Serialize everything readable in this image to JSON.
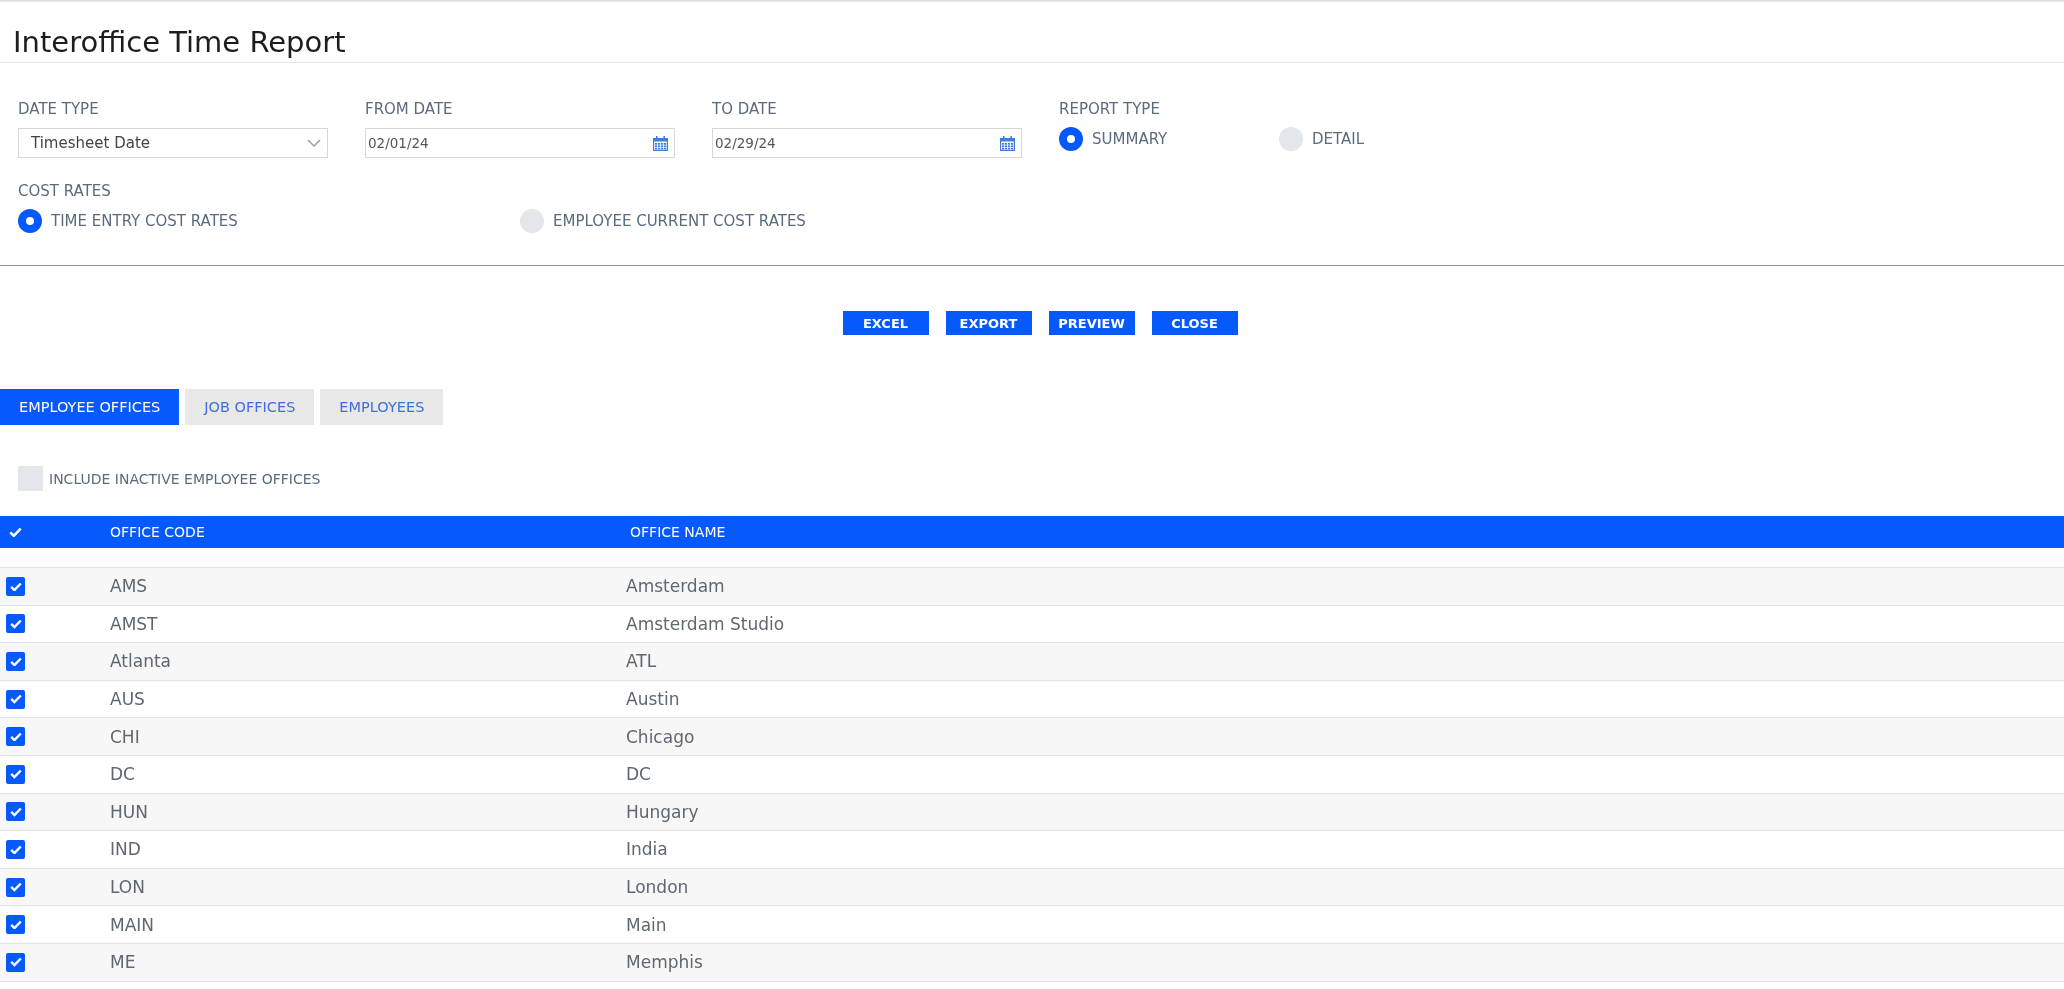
{
  "page": {
    "title": "Interoffice Time Report"
  },
  "filters": {
    "date_type": {
      "label": "DATE TYPE",
      "value": "Timesheet Date"
    },
    "from_date": {
      "label": "FROM DATE",
      "value": "02/01/24"
    },
    "to_date": {
      "label": "TO DATE",
      "value": "02/29/24"
    },
    "report_type": {
      "label": "REPORT TYPE",
      "options": [
        {
          "label": "SUMMARY",
          "selected": true
        },
        {
          "label": "DETAIL",
          "selected": false
        }
      ]
    },
    "cost_rates": {
      "label": "COST RATES",
      "options": [
        {
          "label": "TIME ENTRY COST RATES",
          "selected": true
        },
        {
          "label": "EMPLOYEE CURRENT COST RATES",
          "selected": false
        }
      ]
    }
  },
  "actions": [
    {
      "label": "EXCEL"
    },
    {
      "label": "EXPORT"
    },
    {
      "label": "PREVIEW"
    },
    {
      "label": "CLOSE"
    }
  ],
  "tabs": [
    {
      "label": "EMPLOYEE OFFICES",
      "selected": true
    },
    {
      "label": "JOB OFFICES",
      "selected": false
    },
    {
      "label": "EMPLOYEES",
      "selected": false
    }
  ],
  "include_inactive": {
    "label": "INCLUDE INACTIVE EMPLOYEE OFFICES",
    "checked": false
  },
  "table": {
    "all_checked": true,
    "columns": [
      "OFFICE CODE",
      "OFFICE NAME"
    ],
    "rows": [
      {
        "code": "AMS",
        "name": "Amsterdam",
        "checked": true
      },
      {
        "code": "AMST",
        "name": "Amsterdam Studio",
        "checked": true
      },
      {
        "code": "Atlanta",
        "name": "ATL",
        "checked": true
      },
      {
        "code": "AUS",
        "name": "Austin",
        "checked": true
      },
      {
        "code": "CHI",
        "name": "Chicago",
        "checked": true
      },
      {
        "code": "DC",
        "name": "DC",
        "checked": true
      },
      {
        "code": "HUN",
        "name": "Hungary",
        "checked": true
      },
      {
        "code": "IND",
        "name": "India",
        "checked": true
      },
      {
        "code": "LON",
        "name": "London",
        "checked": true
      },
      {
        "code": "MAIN",
        "name": "Main",
        "checked": true
      },
      {
        "code": "ME",
        "name": "Memphis",
        "checked": true
      }
    ]
  }
}
